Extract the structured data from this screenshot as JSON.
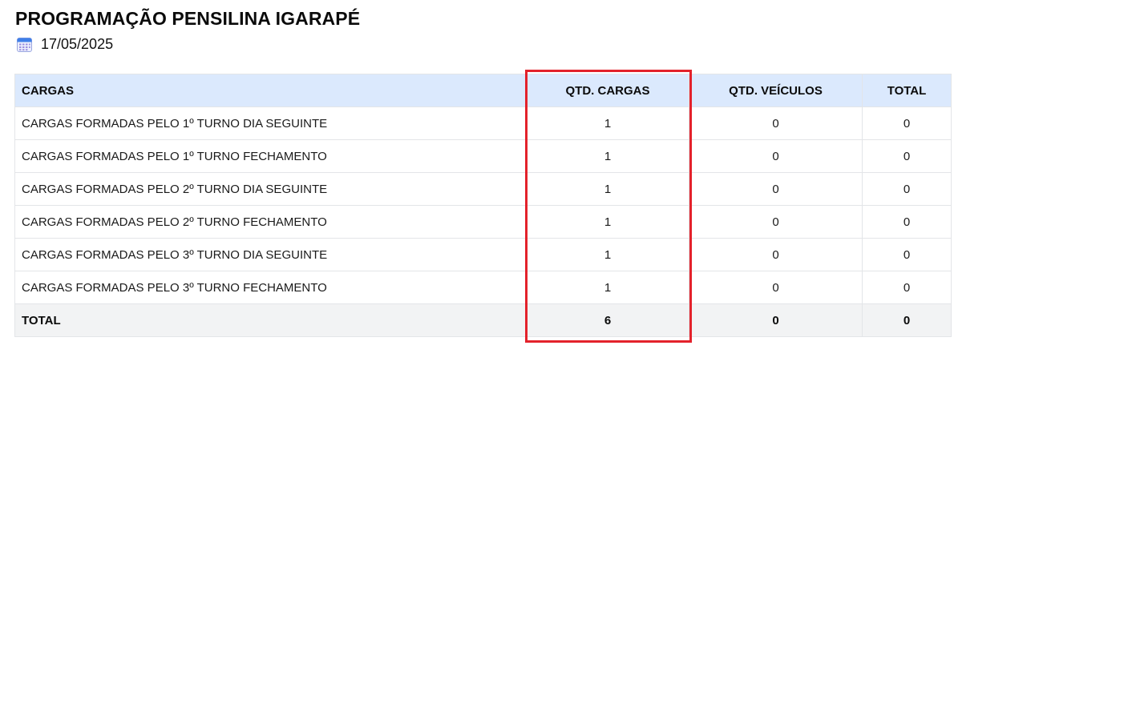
{
  "header": {
    "title": "PROGRAMAÇÃO PENSILINA IGARAPÉ",
    "date": "17/05/2025",
    "date_icon": "calendar-icon"
  },
  "table": {
    "columns": [
      "CARGAS",
      "QTD. CARGAS",
      "QTD. VEÍCULOS",
      "TOTAL"
    ],
    "rows": [
      {
        "desc": "CARGAS FORMADAS PELO 1º TURNO DIA SEGUINTE",
        "qtd_cargas": "1",
        "qtd_veiculos": "0",
        "total": "0"
      },
      {
        "desc": "CARGAS FORMADAS PELO 1º TURNO FECHAMENTO",
        "qtd_cargas": "1",
        "qtd_veiculos": "0",
        "total": "0"
      },
      {
        "desc": "CARGAS FORMADAS PELO 2º TURNO DIA SEGUINTE",
        "qtd_cargas": "1",
        "qtd_veiculos": "0",
        "total": "0"
      },
      {
        "desc": "CARGAS FORMADAS PELO 2º TURNO FECHAMENTO",
        "qtd_cargas": "1",
        "qtd_veiculos": "0",
        "total": "0"
      },
      {
        "desc": "CARGAS FORMADAS PELO 3º TURNO DIA SEGUINTE",
        "qtd_cargas": "1",
        "qtd_veiculos": "0",
        "total": "0"
      },
      {
        "desc": "CARGAS FORMADAS PELO 3º TURNO FECHAMENTO",
        "qtd_cargas": "1",
        "qtd_veiculos": "0",
        "total": "0"
      }
    ],
    "total_row": {
      "desc": "TOTAL",
      "qtd_cargas": "6",
      "qtd_veiculos": "0",
      "total": "0"
    }
  },
  "colors": {
    "header_bg": "#dbe9fd",
    "total_row_bg": "#f2f3f4",
    "highlight_border": "#e3222b"
  }
}
